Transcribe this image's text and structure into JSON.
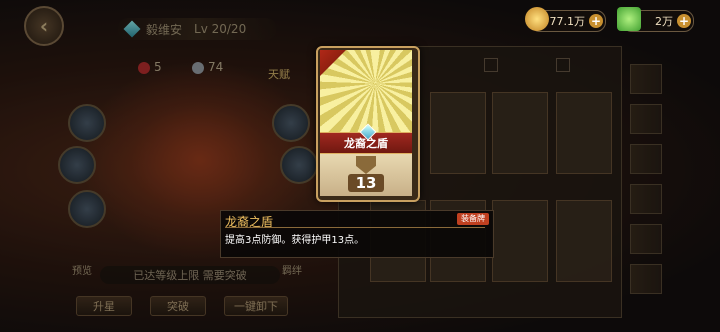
{
  "header": {
    "hero_name": "毅维安",
    "level": "Lv 20/20"
  },
  "resources": {
    "gold": "77.1万",
    "gems": "2万"
  },
  "stats": {
    "attack": "5",
    "speed": "74"
  },
  "tianfu_label": "天赋",
  "upgrade_status": "已达等级上限 需要突破",
  "side_labels": {
    "left": "预览",
    "right": "羁绊"
  },
  "bottom_buttons": {
    "level_up": "升星",
    "breakthrough": "突破",
    "one_click_remove": "一键卸下"
  },
  "card": {
    "name": "龙裔之盾",
    "armor": "13"
  },
  "tooltip": {
    "title": "龙裔之盾",
    "equipped_tag": "装备牌",
    "description": "提高3点防御。获得护甲13点。"
  },
  "colors": {
    "accent_gold": "#f0c060",
    "card_namebar": "#a02820",
    "tag_red": "#c04020"
  }
}
